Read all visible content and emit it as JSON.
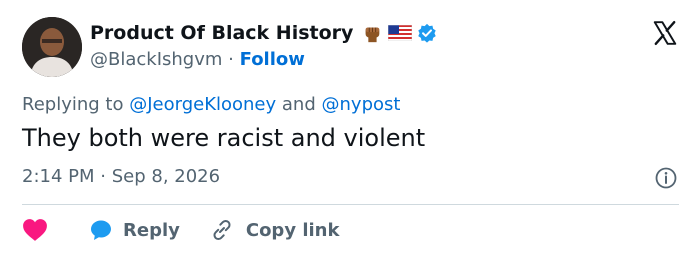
{
  "author": {
    "display_name": "Product Of Black History",
    "handle": "@BlackIshgvm",
    "follow_label": "Follow",
    "separator": "·"
  },
  "reply": {
    "prefix": "Replying to",
    "mention_1": "@JeorgeKlooney",
    "conjunction": "and",
    "mention_2": "@nypost"
  },
  "tweet": {
    "text": "They both were racist and violent",
    "time": "2:14 PM",
    "separator": "·",
    "date": "Sep 8, 2026"
  },
  "actions": {
    "reply_label": "Reply",
    "copy_label": "Copy link"
  },
  "icons": {
    "brand": "x-logo-icon",
    "like": "heart-icon",
    "reply": "speech-bubble-icon",
    "copy": "link-icon",
    "info": "info-icon",
    "verified": "verified-badge-icon",
    "fist": "raised-fist-icon",
    "flag": "us-flag-icon"
  },
  "colors": {
    "link": "#006fd6",
    "like": "#f91880",
    "reply": "#1d9bf0",
    "muted": "#536471",
    "text": "#0f1419",
    "verified": "#1d9bf0"
  }
}
